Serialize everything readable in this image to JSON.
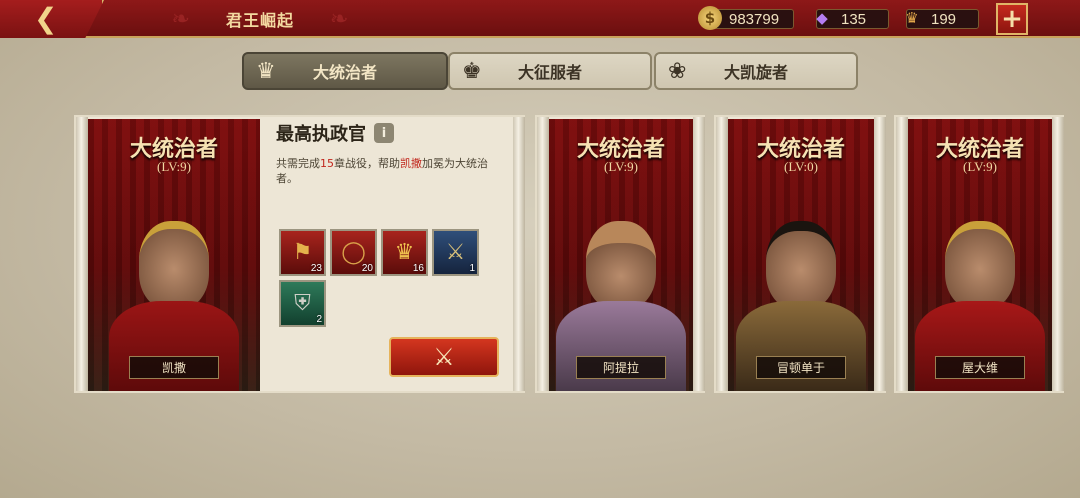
{
  "header": {
    "back_icon": "chevron-left-icon",
    "title": "君王崛起",
    "gold": "983799",
    "gems": "135",
    "tokens": "199",
    "plus_label": "+"
  },
  "tabs": [
    {
      "label": "大统治者",
      "icon": "crown-icon",
      "active": true
    },
    {
      "label": "大征服者",
      "icon": "spiked-crown-icon",
      "active": false
    },
    {
      "label": "大凯旋者",
      "icon": "laurel-wreath-icon",
      "active": false
    }
  ],
  "cards": [
    {
      "title": "大统治者",
      "level": "(LV:9)",
      "name": "凯撒"
    },
    {
      "title": "大统治者",
      "level": "(LV:9)",
      "name": "阿提拉"
    },
    {
      "title": "大统治者",
      "level": "(LV:0)",
      "name": "冒顿单于"
    },
    {
      "title": "大统治者",
      "level": "(LV:9)",
      "name": "屋大维"
    }
  ],
  "info": {
    "title": "最高执政官",
    "desc_pre": "共需完成",
    "desc_num": "15",
    "desc_mid": "章战役，帮助",
    "desc_name": "凯撒",
    "desc_post": "加冕为大统治者。"
  },
  "items": [
    {
      "icon": "helmet-icon",
      "count": "23"
    },
    {
      "icon": "ring-icon",
      "count": "20"
    },
    {
      "icon": "crown-icon",
      "count": "16"
    },
    {
      "icon": "sword-icon",
      "count": "1"
    },
    {
      "icon": "armor-icon",
      "count": "2"
    }
  ],
  "battle_button_icon": "crossed-swords-icon"
}
